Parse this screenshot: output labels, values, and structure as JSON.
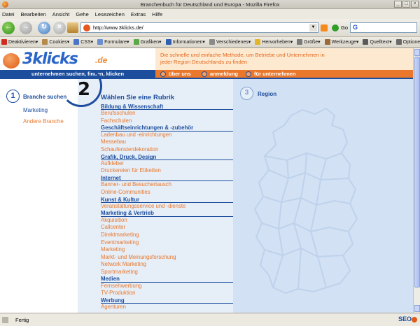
{
  "window": {
    "title": "Branchenbuch für Deutschland und Europa - Mozilla Firefox"
  },
  "menu": [
    "Datei",
    "Bearbeiten",
    "Ansicht",
    "Gehe",
    "Lesezeichen",
    "Extras",
    "Hilfe"
  ],
  "nav": {
    "url": "http://www.3klicks.de/",
    "go_label": "Go",
    "search_placeholder": ""
  },
  "devbar": [
    {
      "label": "Deaktivieren▾",
      "icon": "disable-icon",
      "color": "#d22a1e"
    },
    {
      "label": "Cookies▾",
      "icon": "cookie-icon",
      "color": "#b88a4a"
    },
    {
      "label": "CSS▾",
      "icon": "css-icon",
      "color": "#4a74c9"
    },
    {
      "label": "Formulare▾",
      "icon": "form-icon",
      "color": "#6a8ed0"
    },
    {
      "label": "Grafiken▾",
      "icon": "image-icon",
      "color": "#5aa84a"
    },
    {
      "label": "Informationen▾",
      "icon": "info-icon",
      "color": "#2e5fb0"
    },
    {
      "label": "Verschiedenes▾",
      "icon": "misc-icon",
      "color": "#8a8a8a"
    },
    {
      "label": "Hervorheben▾",
      "icon": "highlight-icon",
      "color": "#e3b52a"
    },
    {
      "label": "Größe▾",
      "icon": "resize-icon",
      "color": "#7a7a7a"
    },
    {
      "label": "Werkzeuge▾",
      "icon": "tools-icon",
      "color": "#9a6a3a"
    },
    {
      "label": "Quelltext▾",
      "icon": "source-icon",
      "color": "#5a5a5a"
    },
    {
      "label": "Optionen▾",
      "icon": "options-icon",
      "color": "#6a6a6a"
    }
  ],
  "site": {
    "logo_text": "3klicks",
    "logo_suffix": ".de",
    "tagline": "Die schnelle und einfache Methode, um Betriebe und Unternehmen in jeder Region Deutschlands zu finden",
    "slogan": "unternehmen suchen, finden, klicken",
    "links": [
      "über uns",
      "anmeldung",
      "für unternehmen"
    ],
    "accent": "#e9782c",
    "brand": "#1d4e9d"
  },
  "step1": {
    "number": "1",
    "label": "Branche suchen",
    "links": [
      "Marketing",
      "Andere Branche"
    ]
  },
  "step2": {
    "number": "2",
    "title": "Wählen Sie eine Rubrik",
    "rubriken": [
      {
        "name": "Bildung & Wissenschaft",
        "items": [
          "Berufsschulen",
          "Fachschulen"
        ]
      },
      {
        "name": "Geschäftseinrichtungen & -zubehör",
        "items": [
          "Ladenbau und -einrichtungen",
          "Messebau",
          "Schaufensterdekoration"
        ]
      },
      {
        "name": "Grafik, Druck, Design",
        "items": [
          "Aufkleber",
          "Druckereien für Etiketten"
        ]
      },
      {
        "name": "Internet",
        "items": [
          "Banner- und Besuchertausch",
          "Online-Communities"
        ]
      },
      {
        "name": "Kunst & Kultur",
        "items": [
          "Veranstaltungsservice und -dienste"
        ]
      },
      {
        "name": "Marketing & Vertrieb",
        "items": [
          "Akquisition",
          "Callcenter",
          "Direktmarketing",
          "Eventmarketing",
          "Marketing",
          "Markt- und Meinungsforschung",
          "Network Marketing",
          "Sportmarketing"
        ]
      },
      {
        "name": "Medien",
        "items": [
          "Fernsehwerbung",
          "TV-Produktion"
        ]
      },
      {
        "name": "Werbung",
        "items": [
          "Agenturen"
        ]
      }
    ]
  },
  "step3": {
    "number": "3",
    "label": "Region"
  },
  "status": {
    "text": "Fertig",
    "badge": "SEO"
  }
}
